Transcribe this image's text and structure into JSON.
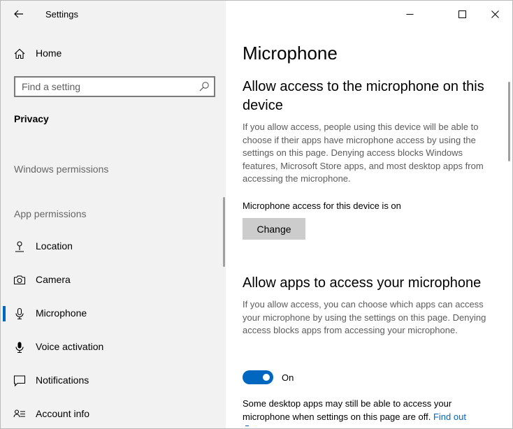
{
  "window": {
    "title": "Settings",
    "minimize_label": "Minimize",
    "maximize_label": "Maximize",
    "close_label": "Close"
  },
  "sidebar": {
    "home_label": "Home",
    "search_placeholder": "Find a setting",
    "section_privacy": "Privacy",
    "group_windows_permissions": "Windows permissions",
    "group_app_permissions": "App permissions",
    "items": [
      {
        "label": "Location",
        "icon": "location-pin-icon"
      },
      {
        "label": "Camera",
        "icon": "camera-icon"
      },
      {
        "label": "Microphone",
        "icon": "microphone-icon",
        "selected": true
      },
      {
        "label": "Voice activation",
        "icon": "voice-activation-icon"
      },
      {
        "label": "Notifications",
        "icon": "notifications-icon"
      },
      {
        "label": "Account info",
        "icon": "account-info-icon"
      }
    ]
  },
  "main": {
    "page_title": "Microphone",
    "device_section": {
      "heading_line1": "Allow access to the microphone on this",
      "heading_line2": "device",
      "description": "If you allow access, people using this device will be able to choose if their apps have microphone access by using the settings on this page. Denying access blocks Windows features, Microsoft Store apps, and most desktop apps from accessing the microphone.",
      "status": "Microphone access for this device is on",
      "change_button": "Change"
    },
    "apps_section": {
      "heading": "Allow apps to access your microphone",
      "description": "If you allow access, you can choose which apps can access your microphone by using the settings on this page. Denying access blocks apps from accessing your microphone.",
      "toggle_state": "On",
      "toggle_on": true,
      "note_text": "Some desktop apps may still be able to access your microphone when settings on this page are off.",
      "note_link": "Find out"
    }
  },
  "colors": {
    "accent": "#0067c0",
    "sidebar_bg": "#f2f2f2",
    "button_bg": "#cccccc",
    "description_text": "#5c5c5c"
  }
}
